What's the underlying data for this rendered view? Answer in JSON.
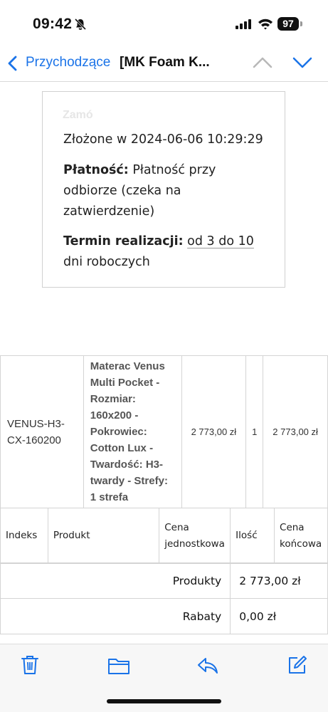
{
  "status": {
    "time": "09:42",
    "battery": "97"
  },
  "nav": {
    "back_label": "Przychodzące",
    "subject": "[MK Foam K..."
  },
  "order": {
    "cut_heading": "Zamó",
    "placed": "Złożone w 2024-06-06 10:29:29",
    "payment_label": "Płatność:",
    "payment_l1": "Płatność przy",
    "payment_l2": "odbiorze (czeka na",
    "payment_l3": "zatwierdzenie)",
    "term_label": "Termin realizacji:",
    "term_value": "od 3 do 10",
    "term_l2": "dni roboczych"
  },
  "item": {
    "sku_l1": "VENUS-H3-",
    "sku_l2": "CX-160200",
    "name_lines": [
      "Materac Venus",
      "Multi Pocket -",
      "Rozmiar:",
      "160x200 -",
      "Pokrowiec:",
      "Cotton Lux -",
      "Twardość: H3-",
      "twardy - Strefy:",
      "1 strefa"
    ],
    "unit_price": "2 773,00 zł",
    "qty": "1",
    "total": "2 773,00 zł"
  },
  "headers": {
    "index": "Indeks",
    "product": "Produkt",
    "unit_l1": "Cena",
    "unit_l2": "jednostkowa",
    "qty": "Ilość",
    "total_l1": "Cena",
    "total_l2": "końcowa"
  },
  "summary": [
    {
      "label": "Produkty",
      "value": "2 773,00 zł"
    },
    {
      "label": "Rabaty",
      "value": "0,00 zł"
    }
  ]
}
